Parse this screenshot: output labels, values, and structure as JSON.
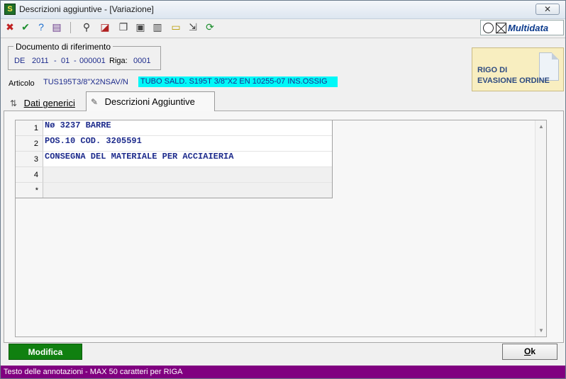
{
  "window": {
    "title": "Descrizioni aggiuntive - [Variazione]",
    "app_icon_text": "S",
    "close_glyph": "✕"
  },
  "toolbar": {
    "items": [
      {
        "icon": "cancel-x-icon",
        "glyph": "✖",
        "color": "#c02020"
      },
      {
        "icon": "confirm-check-icon",
        "glyph": "✔",
        "color": "#1f8f2f"
      },
      {
        "icon": "help-icon",
        "glyph": "?",
        "color": "#1d6fd0"
      },
      {
        "icon": "book-icon",
        "glyph": "▤",
        "color": "#6a3a8a"
      },
      {
        "icon": "binoculars-icon",
        "glyph": "⚲",
        "color": "#333333"
      },
      {
        "icon": "erase-icon",
        "glyph": "◪",
        "color": "#b02020"
      },
      {
        "icon": "copy-icon",
        "glyph": "❐",
        "color": "#444444"
      },
      {
        "icon": "paste-icon",
        "glyph": "▣",
        "color": "#444444"
      },
      {
        "icon": "document-icon",
        "glyph": "▥",
        "color": "#444444"
      },
      {
        "icon": "note-icon",
        "glyph": "▭",
        "color": "#b89b00"
      },
      {
        "icon": "import-icon",
        "glyph": "⇲",
        "color": "#444444"
      },
      {
        "icon": "refresh-icon",
        "glyph": "⟳",
        "color": "#1f8f2f"
      }
    ]
  },
  "logo": {
    "text": "Multidata"
  },
  "reference": {
    "legend": "Documento di riferimento",
    "doc_type": "DE",
    "year": "2011",
    "sep1": "-",
    "series": "01",
    "sep2": "-",
    "number": "000001",
    "riga_label": "Riga:",
    "riga_value": "0001"
  },
  "rigo_evasione": {
    "line1": "RIGO DI",
    "line2": "EVASIONE ORDINE"
  },
  "articolo": {
    "label": "Articolo",
    "code": "TUS195T3/8\"X2NSAV/N",
    "description": "TUBO SALD. S195T 3/8\"X2 EN 10255-07 INS.OSSIG"
  },
  "tabs": [
    {
      "label": "Dati generici",
      "active": false
    },
    {
      "label": "Descrizioni Aggiuntive",
      "active": true
    }
  ],
  "grid": {
    "rows": [
      {
        "num": "1",
        "text": "Nø 3237 BARRE"
      },
      {
        "num": "2",
        "text": "POS.10 COD. 3205591"
      },
      {
        "num": "3",
        "text": "CONSEGNA DEL MATERIALE PER ACCIAIERIA"
      },
      {
        "num": "4",
        "text": ""
      },
      {
        "num": "*",
        "text": ""
      }
    ]
  },
  "buttons": {
    "modifica": "Modifica",
    "ok_first": "O",
    "ok_rest": "k"
  },
  "status": {
    "text": "Testo delle annotazioni - MAX 50 caratteri per RIGA"
  }
}
